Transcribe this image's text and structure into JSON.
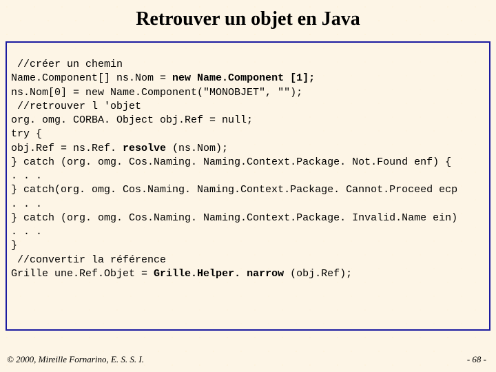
{
  "title": "Retrouver un objet en Java",
  "code": {
    "l1": " //créer un chemin",
    "l2a": "Name.Component[] ns.Nom = ",
    "l2b": "new Name.Component [1];",
    "l3": "ns.Nom[0] = new Name.Component(\"MONOBJET\", \"\");",
    "l4": " //retrouver l 'objet",
    "l5": "org. omg. CORBA. Object obj.Ref = null;",
    "l6": "try {",
    "l7a": "obj.Ref = ns.Ref. ",
    "l7b": "resolve",
    "l7c": " (ns.Nom);",
    "l8": "} catch (org. omg. Cos.Naming. Naming.Context.Package. Not.Found enf) {",
    "l9": ". . .",
    "l10": "} catch(org. omg. Cos.Naming. Naming.Context.Package. Cannot.Proceed ecp",
    "l11": ". . .",
    "l12": "} catch (org. omg. Cos.Naming. Naming.Context.Package. Invalid.Name ein)",
    "l13": ". . .",
    "l14": "}",
    "l15": " //convertir la référence",
    "l16a": "Grille une.Ref.Objet = ",
    "l16b": "Grille.Helper. narrow",
    "l16c": " (obj.Ref);"
  },
  "footer": {
    "left": "© 2000, Mireille Fornarino, E. S. S. I.",
    "right": "- 68 -"
  }
}
